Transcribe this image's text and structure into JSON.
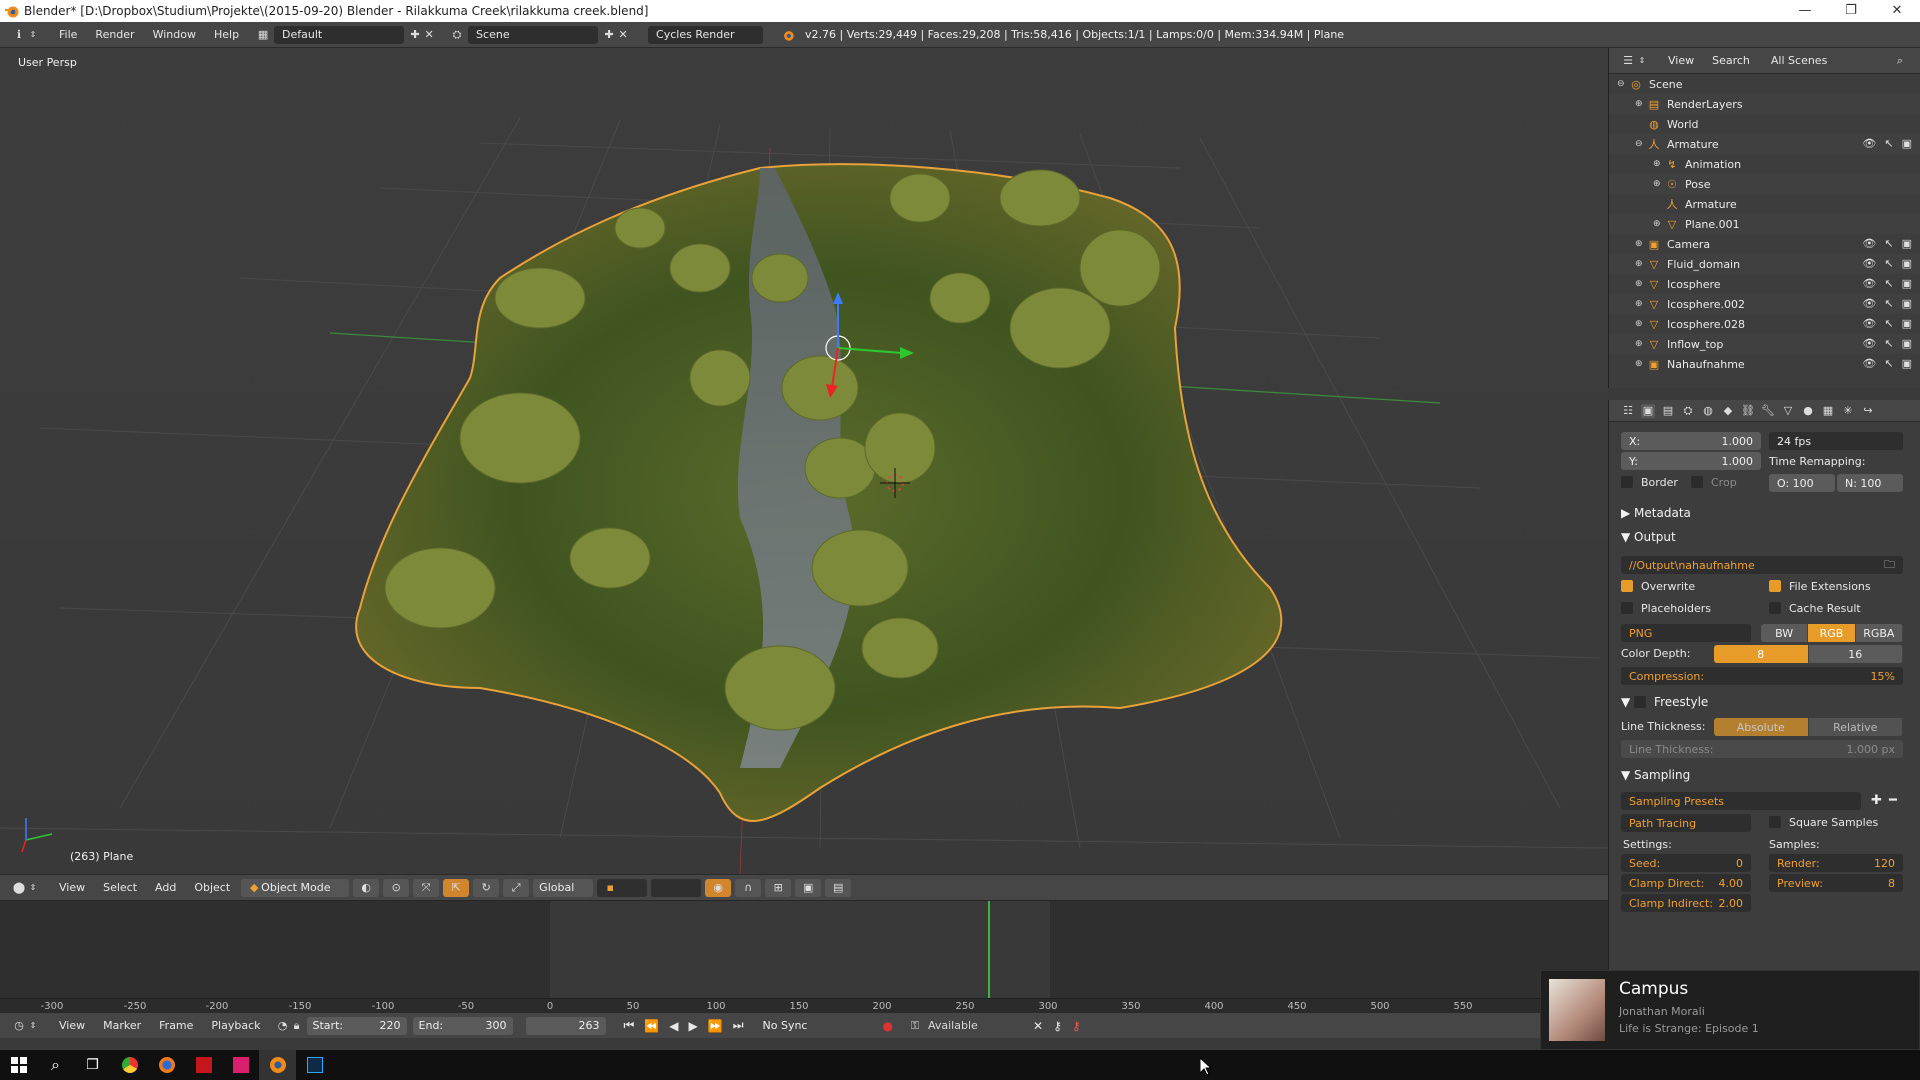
{
  "window": {
    "title": "Blender* [D:\\Dropbox\\Studium\\Projekte\\(2015-09-20) Blender - Rilakkuma Creek\\rilakkuma creek.blend]",
    "controls": [
      "—",
      "❐",
      "✕"
    ]
  },
  "info_header": {
    "menus": [
      "File",
      "Render",
      "Window",
      "Help"
    ],
    "screen_layout": "Default",
    "scene": "Scene",
    "render_engine": "Cycles Render",
    "stats": "v2.76 | Verts:29,449 | Faces:29,208 | Tris:58,416 | Objects:1/1 | Lamps:0/0 | Mem:334.94M | Plane"
  },
  "viewport": {
    "view_label": "User Persp",
    "object_label": "(263) Plane",
    "header": {
      "menus": [
        "View",
        "Select",
        "Add",
        "Object"
      ],
      "mode": "Object Mode",
      "orientation": "Global"
    }
  },
  "timeline": {
    "header_menus": [
      "View",
      "Marker",
      "Frame",
      "Playback"
    ],
    "start_label": "Start:",
    "start": "220",
    "end_label": "End:",
    "end": "300",
    "current": "263",
    "sync": "No Sync",
    "keying": "Available",
    "ruler_labels": [
      "-300",
      "-250",
      "-200",
      "-150",
      "-100",
      "-50",
      "0",
      "50",
      "100",
      "150",
      "200",
      "250",
      "300",
      "350",
      "400",
      "450",
      "500",
      "550",
      "6"
    ]
  },
  "outliner": {
    "header": {
      "view": "View",
      "search": "Search",
      "filter": "All Scenes"
    },
    "rows": [
      {
        "label": "Scene",
        "indent": 0,
        "icon": "scene-icon",
        "glyph": "◎",
        "exp": "⊖"
      },
      {
        "label": "RenderLayers",
        "indent": 1,
        "icon": "render-layers-icon",
        "glyph": "▤",
        "exp": "⊕"
      },
      {
        "label": "World",
        "indent": 1,
        "icon": "world-icon",
        "glyph": "◍",
        "exp": ""
      },
      {
        "label": "Armature",
        "indent": 1,
        "icon": "armature-icon",
        "glyph": "⼈",
        "exp": "⊖"
      },
      {
        "label": "Animation",
        "indent": 2,
        "icon": "animation-icon",
        "glyph": "↯",
        "exp": "⊕"
      },
      {
        "label": "Pose",
        "indent": 2,
        "icon": "pose-icon",
        "glyph": "☉",
        "exp": "⊕"
      },
      {
        "label": "Armature",
        "indent": 2,
        "icon": "armature-data-icon",
        "glyph": "⼈",
        "exp": ""
      },
      {
        "label": "Plane.001",
        "indent": 2,
        "icon": "mesh-icon",
        "glyph": "▽",
        "exp": "⊕"
      },
      {
        "label": "Camera",
        "indent": 1,
        "icon": "camera-icon",
        "glyph": "▣",
        "exp": "⊕"
      },
      {
        "label": "Fluid_domain",
        "indent": 1,
        "icon": "mesh-icon",
        "glyph": "▽",
        "exp": "⊕"
      },
      {
        "label": "Icosphere",
        "indent": 1,
        "icon": "mesh-icon",
        "glyph": "▽",
        "exp": "⊕"
      },
      {
        "label": "Icosphere.002",
        "indent": 1,
        "icon": "mesh-icon",
        "glyph": "▽",
        "exp": "⊕"
      },
      {
        "label": "Icosphere.028",
        "indent": 1,
        "icon": "mesh-icon",
        "glyph": "▽",
        "exp": "⊕"
      },
      {
        "label": "Inflow_top",
        "indent": 1,
        "icon": "mesh-icon",
        "glyph": "▽",
        "exp": "⊕"
      },
      {
        "label": "Nahaufnahme",
        "indent": 1,
        "icon": "camera-icon",
        "glyph": "▣",
        "exp": "⊕"
      }
    ]
  },
  "properties": {
    "aspect": {
      "x_label": "X:",
      "x": "1.000",
      "y_label": "Y:",
      "y": "1.000"
    },
    "frame_rate": "24 fps",
    "time_remap_label": "Time Remapping:",
    "time_remap_old": "O: 100",
    "time_remap_new": "N: 100",
    "border_label": "Border",
    "crop_label": "Crop",
    "metadata_label": "Metadata",
    "output_label": "Output",
    "output_path": "//Output\\nahaufnahme",
    "overwrite_label": "Overwrite",
    "file_ext_label": "File Extensions",
    "placeholders_label": "Placeholders",
    "cache_result_label": "Cache Result",
    "format": "PNG",
    "color_modes": [
      "BW",
      "RGB",
      "RGBA"
    ],
    "color_depth_label": "Color Depth:",
    "color_depths": [
      "8",
      "16"
    ],
    "compression_label": "Compression:",
    "compression": "15%",
    "freestyle_label": "Freestyle",
    "line_thickness_label": "Line Thickness:",
    "line_thickness_modes": [
      "Absolute",
      "Relative"
    ],
    "line_thickness_field_label": "Line Thickness:",
    "line_thickness_value": "1.000 px",
    "sampling_label": "Sampling",
    "sampling_presets": "Sampling Presets",
    "integrator": "Path Tracing",
    "square_samples_label": "Square Samples",
    "settings_label": "Settings:",
    "samples_label": "Samples:",
    "seed_label": "Seed:",
    "seed": "0",
    "render_label": "Render:",
    "render_samples": "120",
    "clamp_direct_label": "Clamp Direct:",
    "clamp_direct": "4.00",
    "preview_label": "Preview:",
    "preview_samples": "8",
    "clamp_indirect_label": "Clamp Indirect:",
    "clamp_indirect": "2.00"
  },
  "toast": {
    "title": "Campus",
    "artist": "Jonathan Morali",
    "album": "Life is Strange: Episode 1"
  },
  "colors": {
    "accent": "#e79c29",
    "selection_outline": "#e8a23a",
    "playhead": "#3fb43f"
  }
}
